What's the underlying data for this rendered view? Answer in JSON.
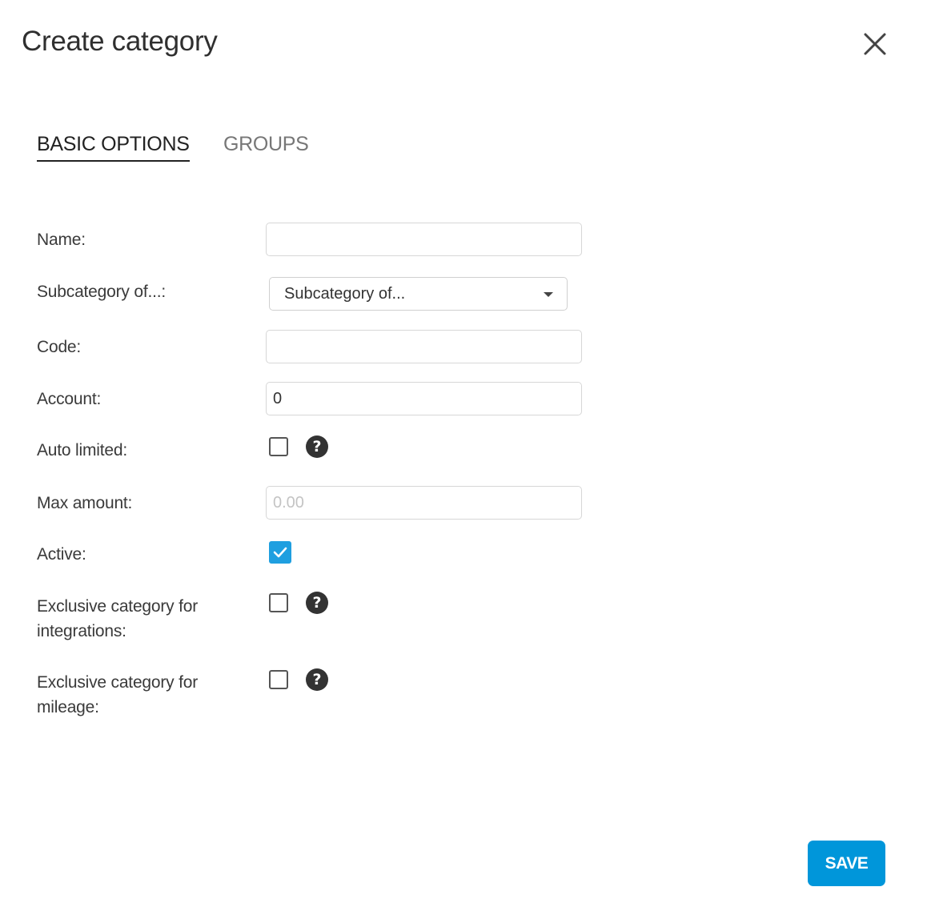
{
  "dialog": {
    "title": "Create category",
    "close_icon": "close-icon"
  },
  "tabs": [
    {
      "label": "BASIC OPTIONS",
      "active": true
    },
    {
      "label": "GROUPS",
      "active": false
    }
  ],
  "form": {
    "name": {
      "label": "Name:",
      "value": ""
    },
    "subcategory": {
      "label": "Subcategory of...:",
      "value": "Subcategory of..."
    },
    "code": {
      "label": "Code:",
      "value": ""
    },
    "account": {
      "label": "Account:",
      "value": "0"
    },
    "auto_limited": {
      "label": "Auto limited:",
      "checked": false,
      "help_icon": "question-circle-icon"
    },
    "max_amount": {
      "label": "Max amount:",
      "value": "0.00",
      "disabled": true
    },
    "active": {
      "label": "Active:",
      "checked": true
    },
    "exclusive_integrations": {
      "label_line1": "Exclusive category for",
      "label_line2": "integrations:",
      "checked": false,
      "help_icon": "question-circle-icon"
    },
    "exclusive_mileage": {
      "label_line1": "Exclusive category for",
      "label_line2": "mileage:",
      "checked": false,
      "help_icon": "question-circle-icon"
    }
  },
  "footer": {
    "save_label": "SAVE"
  },
  "colors": {
    "primary": "#0096da",
    "checkbox_checked": "#1f9fe0",
    "text": "#333333"
  }
}
